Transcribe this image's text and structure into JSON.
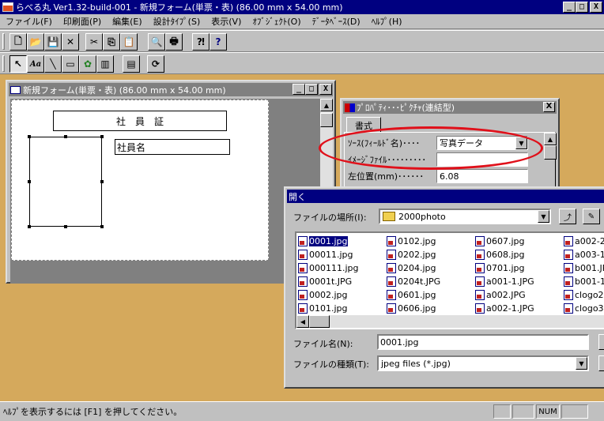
{
  "app": {
    "title": "らべる丸 Ver1.32-build-001 - 新規フォーム(単票・表) (86.00 mm x 54.00 mm)",
    "min": "_",
    "max": "□",
    "close": "X"
  },
  "menu": [
    "ファイル(F)",
    "印刷面(P)",
    "編集(E)",
    "設計ﾀｲﾌﾟ(S)",
    "表示(V)",
    "ｵﾌﾞｼﾞｪｸﾄ(O)",
    "ﾃﾞｰﾀﾍﾞｰｽ(D)",
    "ﾍﾙﾌﾟ(H)"
  ],
  "toolbar1": {
    "icons": [
      "new-icon",
      "open-icon",
      "save-icon",
      "delete-icon",
      "cut-icon",
      "copy-icon",
      "paste-icon",
      "print-preview-icon",
      "print-icon",
      "help-pointer-icon",
      "help-icon"
    ],
    "glyphs": [
      "🗋",
      "📂",
      "💾",
      "✕",
      "✂",
      "⎘",
      "📋",
      "🔍",
      "🖶",
      "⁈",
      "?"
    ]
  },
  "toolbar2": {
    "icons": [
      "select-arrow-icon",
      "text-tool-icon",
      "line-tool-icon",
      "rect-tool-icon",
      "picture-tool-icon",
      "barcode-tool-icon",
      "list-tool-icon",
      "refresh-icon"
    ],
    "glyphs": [
      "↖",
      "Aa",
      "╲",
      "▭",
      "✿",
      "▥",
      "▤",
      "⟳"
    ]
  },
  "form_window": {
    "title": "新規フォーム(単票・表) (86.00 mm x 54.00 mm)",
    "header_text": "社　員　証",
    "name_field": "社員名"
  },
  "property_panel": {
    "title": "ﾌﾟﾛﾊﾟﾃｨ･･･ﾋﾟｸﾁｬ(連結型)",
    "tab": "書式",
    "rows": [
      {
        "label": "ｿｰｽ(ﾌｨｰﾙﾄﾞ名)････",
        "value": "写真データ"
      },
      {
        "label": "ｲﾒｰｼﾞﾌｧｲﾙ･････････",
        "value": ""
      },
      {
        "label": "左位置(mm)･･････",
        "value": "6.08"
      }
    ]
  },
  "open_dialog": {
    "title": "開く",
    "look_in_label": "ファイルの場所(I):",
    "look_in_value": "2000photo",
    "files": [
      [
        "0001.jpg",
        "00011.jpg",
        "000111.jpg",
        "0001t.JPG",
        "0002.jpg",
        "0101.jpg"
      ],
      [
        "0102.jpg",
        "0202.jpg",
        "0204.jpg",
        "0204t.JPG",
        "0601.jpg",
        "0606.jpg"
      ],
      [
        "0607.jpg",
        "0608.jpg",
        "0701.jpg",
        "a001-1.JPG",
        "a002.JPG",
        "a002-1.JPG"
      ],
      [
        "a002-2",
        "a003-1",
        "b001.JP",
        "b001-1",
        "clogo2.",
        "clogo3."
      ]
    ],
    "selected": "0001.jpg",
    "filename_label": "ファイル名(N):",
    "filename_value": "0001.jpg",
    "filetype_label": "ファイルの種類(T):",
    "filetype_value": "jpeg files (*.jpg)"
  },
  "status": {
    "text": "ﾍﾙﾌﾟを表示するには [F1] を押してください。",
    "num": "NUM"
  },
  "colors": {
    "titlebar": "#000080",
    "desktop": "#d5a95c",
    "highlight": "#e0101a"
  }
}
